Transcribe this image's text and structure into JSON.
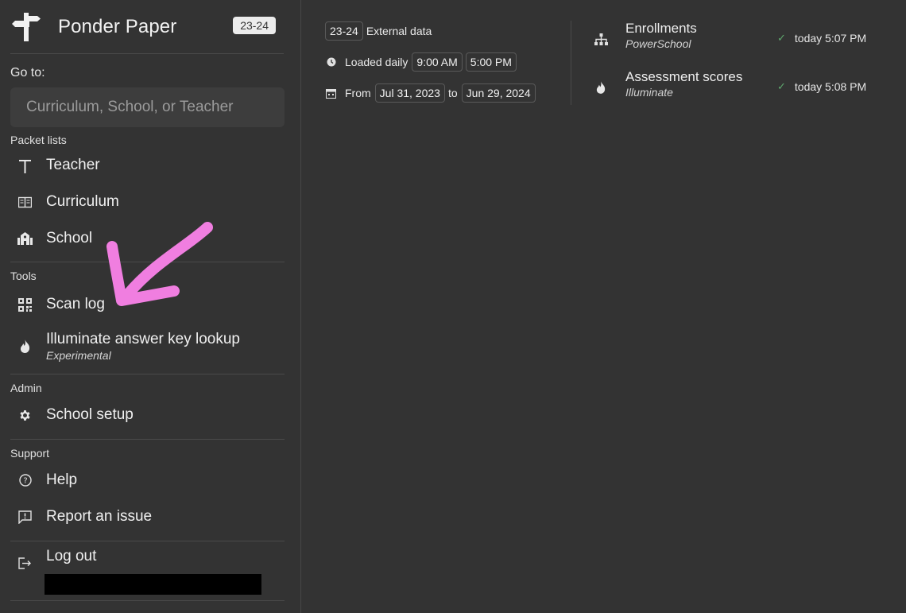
{
  "brand": {
    "title": "Ponder Paper",
    "badge": "23-24"
  },
  "goto": {
    "label": "Go to:",
    "placeholder": "Curriculum, School, or Teacher"
  },
  "sections": {
    "packet_lists": "Packet lists",
    "tools": "Tools",
    "admin": "Admin",
    "support": "Support"
  },
  "nav": {
    "teacher": "Teacher",
    "curriculum": "Curriculum",
    "school": "School",
    "scan_log": "Scan log",
    "illuminate": "Illuminate answer key lookup",
    "illuminate_sub": "Experimental",
    "school_setup": "School setup",
    "help": "Help",
    "report": "Report an issue",
    "logout": "Log out"
  },
  "info": {
    "year_chip": "23-24",
    "external_data": "External data",
    "loaded_daily": "Loaded daily",
    "time1": "9:00 AM",
    "time2": "5:00 PM",
    "from": "From",
    "start": "Jul 31, 2023",
    "to": "to",
    "end": "Jun 29, 2024"
  },
  "sources": [
    {
      "name": "Enrollments",
      "vendor": "PowerSchool",
      "status": "today 5:07 PM",
      "icon": "hierarchy-icon"
    },
    {
      "name": "Assessment scores",
      "vendor": "Illuminate",
      "status": "today 5:08 PM",
      "icon": "flame-icon"
    }
  ],
  "colors": {
    "background": "#333333",
    "annotation": "#f07ee0",
    "check": "#5fa86e"
  }
}
